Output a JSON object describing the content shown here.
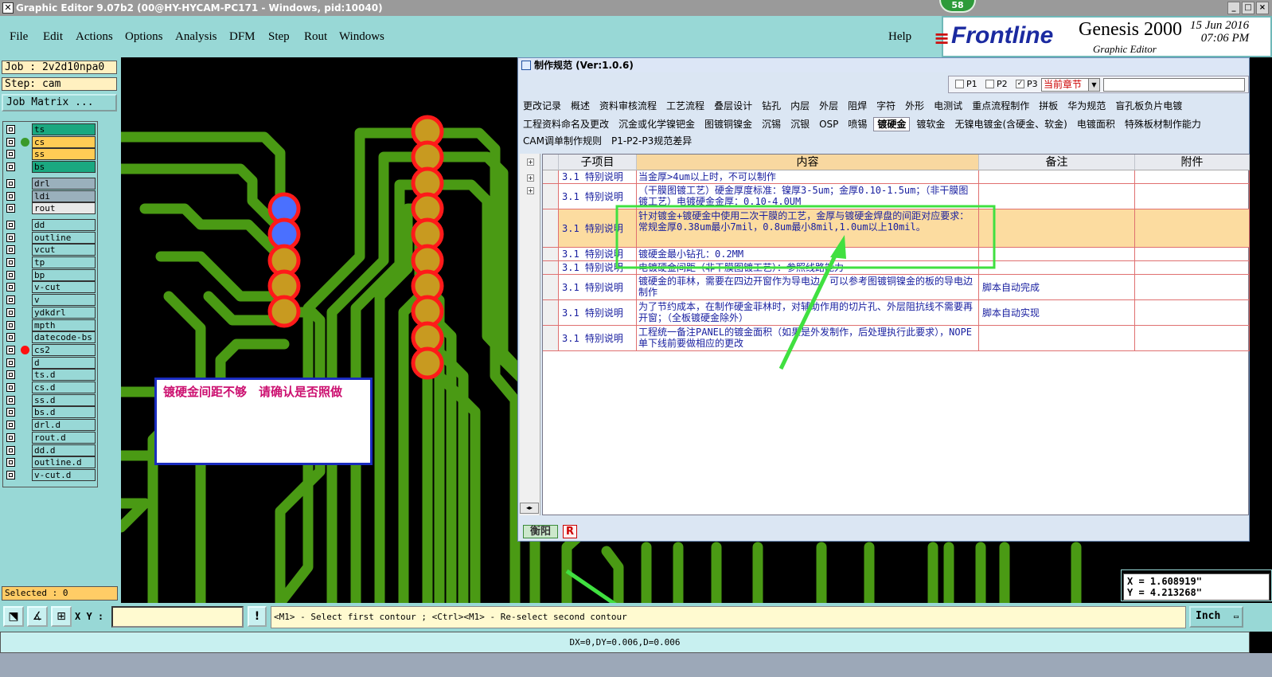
{
  "window": {
    "title": "Graphic Editor 9.07b2 (00@HY-HYCAM-PC171 - Windows, pid:10040)",
    "badge": "58",
    "buttons": {
      "minimize": "_",
      "maximize": "□",
      "close": "×"
    }
  },
  "menu": {
    "items": [
      "File",
      "Edit",
      "Actions",
      "Options",
      "Analysis",
      "DFM",
      "Step",
      "Rout",
      "Windows"
    ],
    "help": "Help"
  },
  "logo": {
    "brand": "Frontline",
    "product": "Genesis 2000",
    "subtitle": "Graphic Editor",
    "date": "15 Jun 2016",
    "time": "07:06 PM"
  },
  "job": {
    "job_label": "Job : 2v2d10npa0",
    "step_label": "Step: cam",
    "matrix_button": "Job Matrix ..."
  },
  "layers": [
    {
      "name": "ts",
      "color": "#1aa880",
      "dot": ""
    },
    {
      "name": "cs",
      "color": "#ffcc55",
      "dot": "#3a9a2a"
    },
    {
      "name": "ss",
      "color": "#ffcc55",
      "dot": ""
    },
    {
      "name": "bs",
      "color": "#1aa880",
      "dot": ""
    },
    {
      "name": "drl",
      "color": "#9ab0bc",
      "dot": ""
    },
    {
      "name": "ldi",
      "color": "#9ab0bc",
      "dot": ""
    },
    {
      "name": "rout",
      "color": "#e8e8e8",
      "dot": ""
    },
    {
      "name": "dd",
      "color": "#98d8d6",
      "dot": ""
    },
    {
      "name": "outline",
      "color": "#98d8d6",
      "dot": ""
    },
    {
      "name": "vcut",
      "color": "#98d8d6",
      "dot": ""
    },
    {
      "name": "tp",
      "color": "#98d8d6",
      "dot": ""
    },
    {
      "name": "bp",
      "color": "#98d8d6",
      "dot": ""
    },
    {
      "name": "v-cut",
      "color": "#98d8d6",
      "dot": ""
    },
    {
      "name": "v",
      "color": "#98d8d6",
      "dot": ""
    },
    {
      "name": "ydkdrl",
      "color": "#98d8d6",
      "dot": ""
    },
    {
      "name": "mpth",
      "color": "#98d8d6",
      "dot": ""
    },
    {
      "name": "datecode-bs",
      "color": "#98d8d6",
      "dot": ""
    },
    {
      "name": "cs2",
      "color": "#98d8d6",
      "dot": "#ff1010"
    },
    {
      "name": "d",
      "color": "#98d8d6",
      "dot": ""
    },
    {
      "name": "ts.d",
      "color": "#98d8d6",
      "dot": ""
    },
    {
      "name": "cs.d",
      "color": "#98d8d6",
      "dot": ""
    },
    {
      "name": "ss.d",
      "color": "#98d8d6",
      "dot": ""
    },
    {
      "name": "bs.d",
      "color": "#98d8d6",
      "dot": ""
    },
    {
      "name": "drl.d",
      "color": "#98d8d6",
      "dot": ""
    },
    {
      "name": "rout.d",
      "color": "#98d8d6",
      "dot": ""
    },
    {
      "name": "dd.d",
      "color": "#98d8d6",
      "dot": ""
    },
    {
      "name": "outline.d",
      "color": "#98d8d6",
      "dot": ""
    },
    {
      "name": "v-cut.d",
      "color": "#98d8d6",
      "dot": ""
    }
  ],
  "selected": "Selected : 0",
  "popup": {
    "text": "镀硬金间距不够　请确认是否照做"
  },
  "dialog": {
    "title": "制作规范 (Ver:1.0.6)",
    "toolbar": {
      "p1": "P1",
      "p2": "P2",
      "p3": "P3",
      "select": "当前章节"
    },
    "tabs_row1": [
      "更改记录",
      "概述",
      "资料审核流程",
      "工艺流程",
      "叠层设计",
      "钻孔",
      "内层",
      "外层",
      "阻焊",
      "字符",
      "外形",
      "电测试",
      "重点流程制作",
      "拼板",
      "华为规范",
      "盲孔板负片电镀"
    ],
    "tabs_row2": [
      "工程资料命名及更改",
      "沉金或化学镍钯金",
      "图镀铜镍金",
      "沉锡",
      "沉银",
      "OSP",
      "喷锡",
      "镀硬金",
      "镀软金",
      "无镍电镀金(含硬金、软金)",
      "电镀面积",
      "特殊板材制作能力"
    ],
    "tabs_row3": [
      "CAM调单制作规则",
      "P1-P2-P3规范差异"
    ],
    "active_tab": "镀硬金",
    "columns": [
      "子项目",
      "内容",
      "备注",
      "附件"
    ],
    "rows": [
      {
        "sub": "3.1 特别说明",
        "content": "当金厚>4um以上时，不可以制作",
        "note": "",
        "h": 17
      },
      {
        "sub": "3.1 特别说明",
        "content": "（干膜图镀工艺）硬金厚度标准：镍厚3-5um；金厚0.10-1.5um；（非干膜图镀工艺）电镀硬金金厚：0.10-4.0UM",
        "note": "",
        "h": 32
      },
      {
        "sub": "3.1 特别说明",
        "content": "针对镀金+镀硬金中使用二次干膜的工艺，金厚与镀硬金焊盘的间距对应要求：常规金厚0.38um最小7mil，0.8um最小8mil,1.0um以上10mil。",
        "note": "",
        "h": 48,
        "hl": true
      },
      {
        "sub": "3.1 特别说明",
        "content": "镀硬金最小钻孔：0.2MM",
        "note": "",
        "h": 17
      },
      {
        "sub": "3.1 特别说明",
        "content": "电镀硬金间距（非干膜图镀工艺）：参照线路能力",
        "note": "",
        "h": 17
      },
      {
        "sub": "3.1 特别说明",
        "content": "镀硬金的菲林，需要在四边开窗作为导电边，可以参考图镀铜镍金的板的导电边制作",
        "note": "脚本自动完成",
        "h": 32
      },
      {
        "sub": "3.1 特别说明",
        "content": "为了节约成本，在制作硬金菲林时，对辅助作用的切片孔、外层阻抗线不需要再开窗；（全板镀硬金除外）",
        "note": "脚本自动实现",
        "h": 32
      },
      {
        "sub": "3.1 特别说明",
        "content": "工程统一备注PANEL的镀金面积（如果是外发制作，后处理执行此要求），NOPE单下线前要做相应的更改",
        "note": "",
        "h": 32
      }
    ],
    "footer": {
      "a": "衡阳",
      "b": "R"
    }
  },
  "coords": {
    "x": "X = 1.608919\"",
    "y": "Y = 4.213268\""
  },
  "bottom": {
    "xy_label": "X Y :",
    "xy_value": "",
    "alert_icon": "!",
    "prompt": "<M1> - Select first contour ; <Ctrl><M1> - Re-select second contour",
    "units": "Inch"
  },
  "status": "DX=0,DY=0.006,D=0.006",
  "colors": {
    "teal": "#98d8d6",
    "trace": "#4a9a14",
    "pad": "#c89a20",
    "pad_ring": "#ff1a1a",
    "pad_blue": "#4a70ff",
    "highlight": "#40e040"
  }
}
